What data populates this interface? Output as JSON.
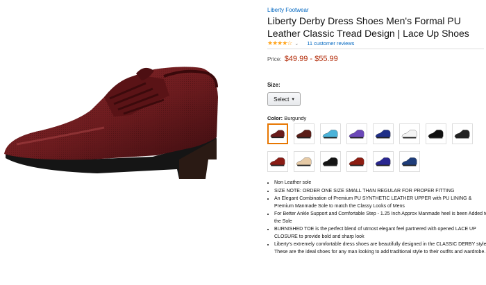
{
  "product": {
    "brand": "Liberty Footwear",
    "title": "Liberty Derby Dress Shoes Men's Formal PU Leather Classic Tread Design | Lace Up Shoes",
    "rating_stars": 4.5,
    "review_count": "11 customer reviews",
    "price_label": "Price:",
    "price_range": "$49.99 - $55.99",
    "size_label": "Size:",
    "size_select": "Select",
    "color_label": "Color:",
    "color_value": "Burgundy",
    "colors": {
      "burgundy": "#6d1a1d",
      "accent_link": "#0066c0",
      "price": "#b12704",
      "star": "#ffa41c"
    },
    "swatches": [
      {
        "color": "#6a1c1c"
      },
      {
        "color": "#5a1d17"
      },
      {
        "color": "#4bb3d9"
      },
      {
        "color": "#6b48b8"
      },
      {
        "color": "#1f2f88"
      },
      {
        "color": "#f4f4f4"
      },
      {
        "color": "#111111"
      },
      {
        "color": "#222222"
      },
      {
        "color": "#8a1c15"
      },
      {
        "color": "#e6caa6"
      },
      {
        "color": "#151515"
      },
      {
        "color": "#8d1d12"
      },
      {
        "color": "#2a2790"
      },
      {
        "color": "#1f3d7a"
      }
    ],
    "bullets": [
      "Non Leather sole",
      "SIZE NOTE: ORDER ONE SIZE SMALL THAN REGULAR FOR PROPER FITTING",
      "An Elegant Combination of Premium PU SYNTHETIC LEATHER UPPER with PU LINING & Premium Manmade Sole to match the Classy Looks of Mens",
      "For Better Ankle Support and Comfortable Step - 1.25 Inch Approx Manmade heel is been Added to the Sole",
      "BURNISHED TOE is the perfect blend of utmost elegant feel partnered with opened LACE UP CLOSURE to provide bold and sharp look",
      "Liberty's extremely comfortable dress shoes are beautifully designed in the CLASSIC DERBY style. These are the ideal shoes for any man looking to add traditional style to their outfits and wardrobe."
    ]
  }
}
